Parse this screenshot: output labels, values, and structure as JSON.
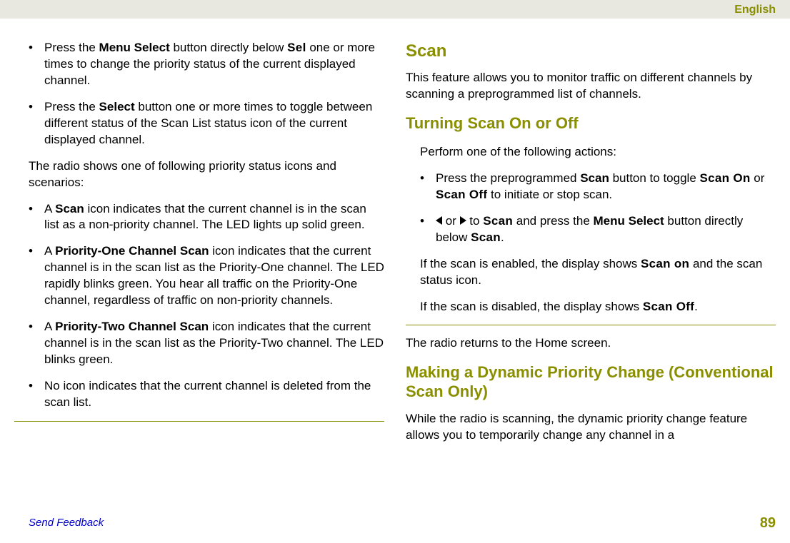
{
  "header": {
    "language": "English"
  },
  "left": {
    "b1_part1": "Press the ",
    "b1_bold1": "Menu Select",
    "b1_part2": " button directly below ",
    "b1_display": "Sel",
    "b1_part3": " one or more times to change the priority status of the current displayed channel.",
    "b2_part1": "Press the ",
    "b2_bold1": "Select",
    "b2_part2": " button one or more times to toggle between different status of the Scan List status icon of the current displayed channel.",
    "p1": "The radio shows one of following priority status icons and scenarios:",
    "b3_part1": "A ",
    "b3_bold1": "Scan",
    "b3_part2": " icon indicates that the current channel is in the scan list as a non-priority channel. The LED lights up solid green.",
    "b4_part1": "A ",
    "b4_bold1": "Priority-One Channel Scan",
    "b4_part2": " icon indicates that the current channel is in the scan list as the Priority-One channel. The LED rapidly blinks green. You hear all traffic on the Priority-One channel, regardless of traffic on non-priority channels.",
    "b5_part1": "A ",
    "b5_bold1": "Priority-Two Channel Scan",
    "b5_part2": " icon indicates that the current channel is in the scan list as the Priority-Two channel. The LED blinks green.",
    "b6": "No icon indicates that the current channel is deleted from the scan list."
  },
  "right": {
    "h_scan": "Scan",
    "scan_p1": "This feature allows you to monitor traffic on different channels by scanning a preprogrammed list of channels.",
    "h_turning": "Turning Scan On or Off",
    "turning_p1": "Perform one of the following actions:",
    "tb1_part1": "Press the preprogrammed ",
    "tb1_bold1": "Scan",
    "tb1_part2": " button to toggle ",
    "tb1_disp1": "Scan On",
    "tb1_part3": " or ",
    "tb1_disp2": "Scan Off",
    "tb1_part4": " to initiate or stop scan.",
    "tb2_part1": " or ",
    "tb2_part2": " to ",
    "tb2_disp1": "Scan",
    "tb2_part3": " and press the ",
    "tb2_bold1": "Menu Select",
    "tb2_part4": " button directly below ",
    "tb2_disp2": "Scan",
    "tb2_part5": ".",
    "tp2_part1": "If the scan is enabled, the display shows ",
    "tp2_disp1": "Scan on",
    "tp2_part2": " and the scan status icon.",
    "tp3_part1": "If the scan is disabled, the display shows ",
    "tp3_disp1": "Scan Off",
    "tp3_part2": ".",
    "post_p1": "The radio returns to the Home screen.",
    "h_dynamic": "Making a Dynamic Priority Change (Conventional Scan Only)",
    "dyn_p1": "While the radio is scanning, the dynamic priority change feature allows you to temporarily change any channel in a"
  },
  "footer": {
    "link": "Send Feedback",
    "page": "89"
  }
}
